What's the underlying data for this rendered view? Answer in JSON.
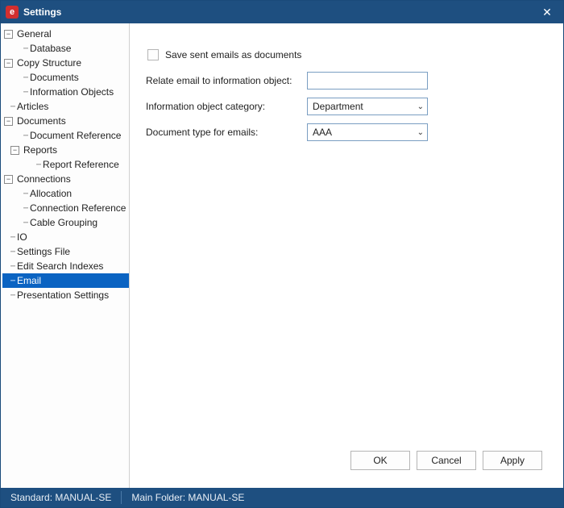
{
  "window": {
    "title": "Settings"
  },
  "tree": {
    "general": "General",
    "general_database": "Database",
    "copy_structure": "Copy Structure",
    "cs_documents": "Documents",
    "cs_info_objects": "Information Objects",
    "articles": "Articles",
    "documents": "Documents",
    "doc_reference": "Document Reference",
    "reports": "Reports",
    "report_reference": "Report Reference",
    "connections": "Connections",
    "conn_allocation": "Allocation",
    "conn_ref": "Connection Reference",
    "conn_cable_group": "Cable Grouping",
    "io": "IO",
    "settings_file": "Settings File",
    "edit_search_indexes": "Edit Search Indexes",
    "email": "Email",
    "presentation_settings": "Presentation Settings"
  },
  "form": {
    "checkbox_label": "Save sent emails as documents",
    "relate_label": "Relate email to information object:",
    "relate_value": "",
    "category_label": "Information object category:",
    "category_value": "Department",
    "doctype_label": "Document type for emails:",
    "doctype_value": "AAA"
  },
  "buttons": {
    "ok": "OK",
    "cancel": "Cancel",
    "apply": "Apply"
  },
  "status": {
    "standard": "Standard: MANUAL-SE",
    "main_folder": "Main Folder: MANUAL-SE"
  }
}
